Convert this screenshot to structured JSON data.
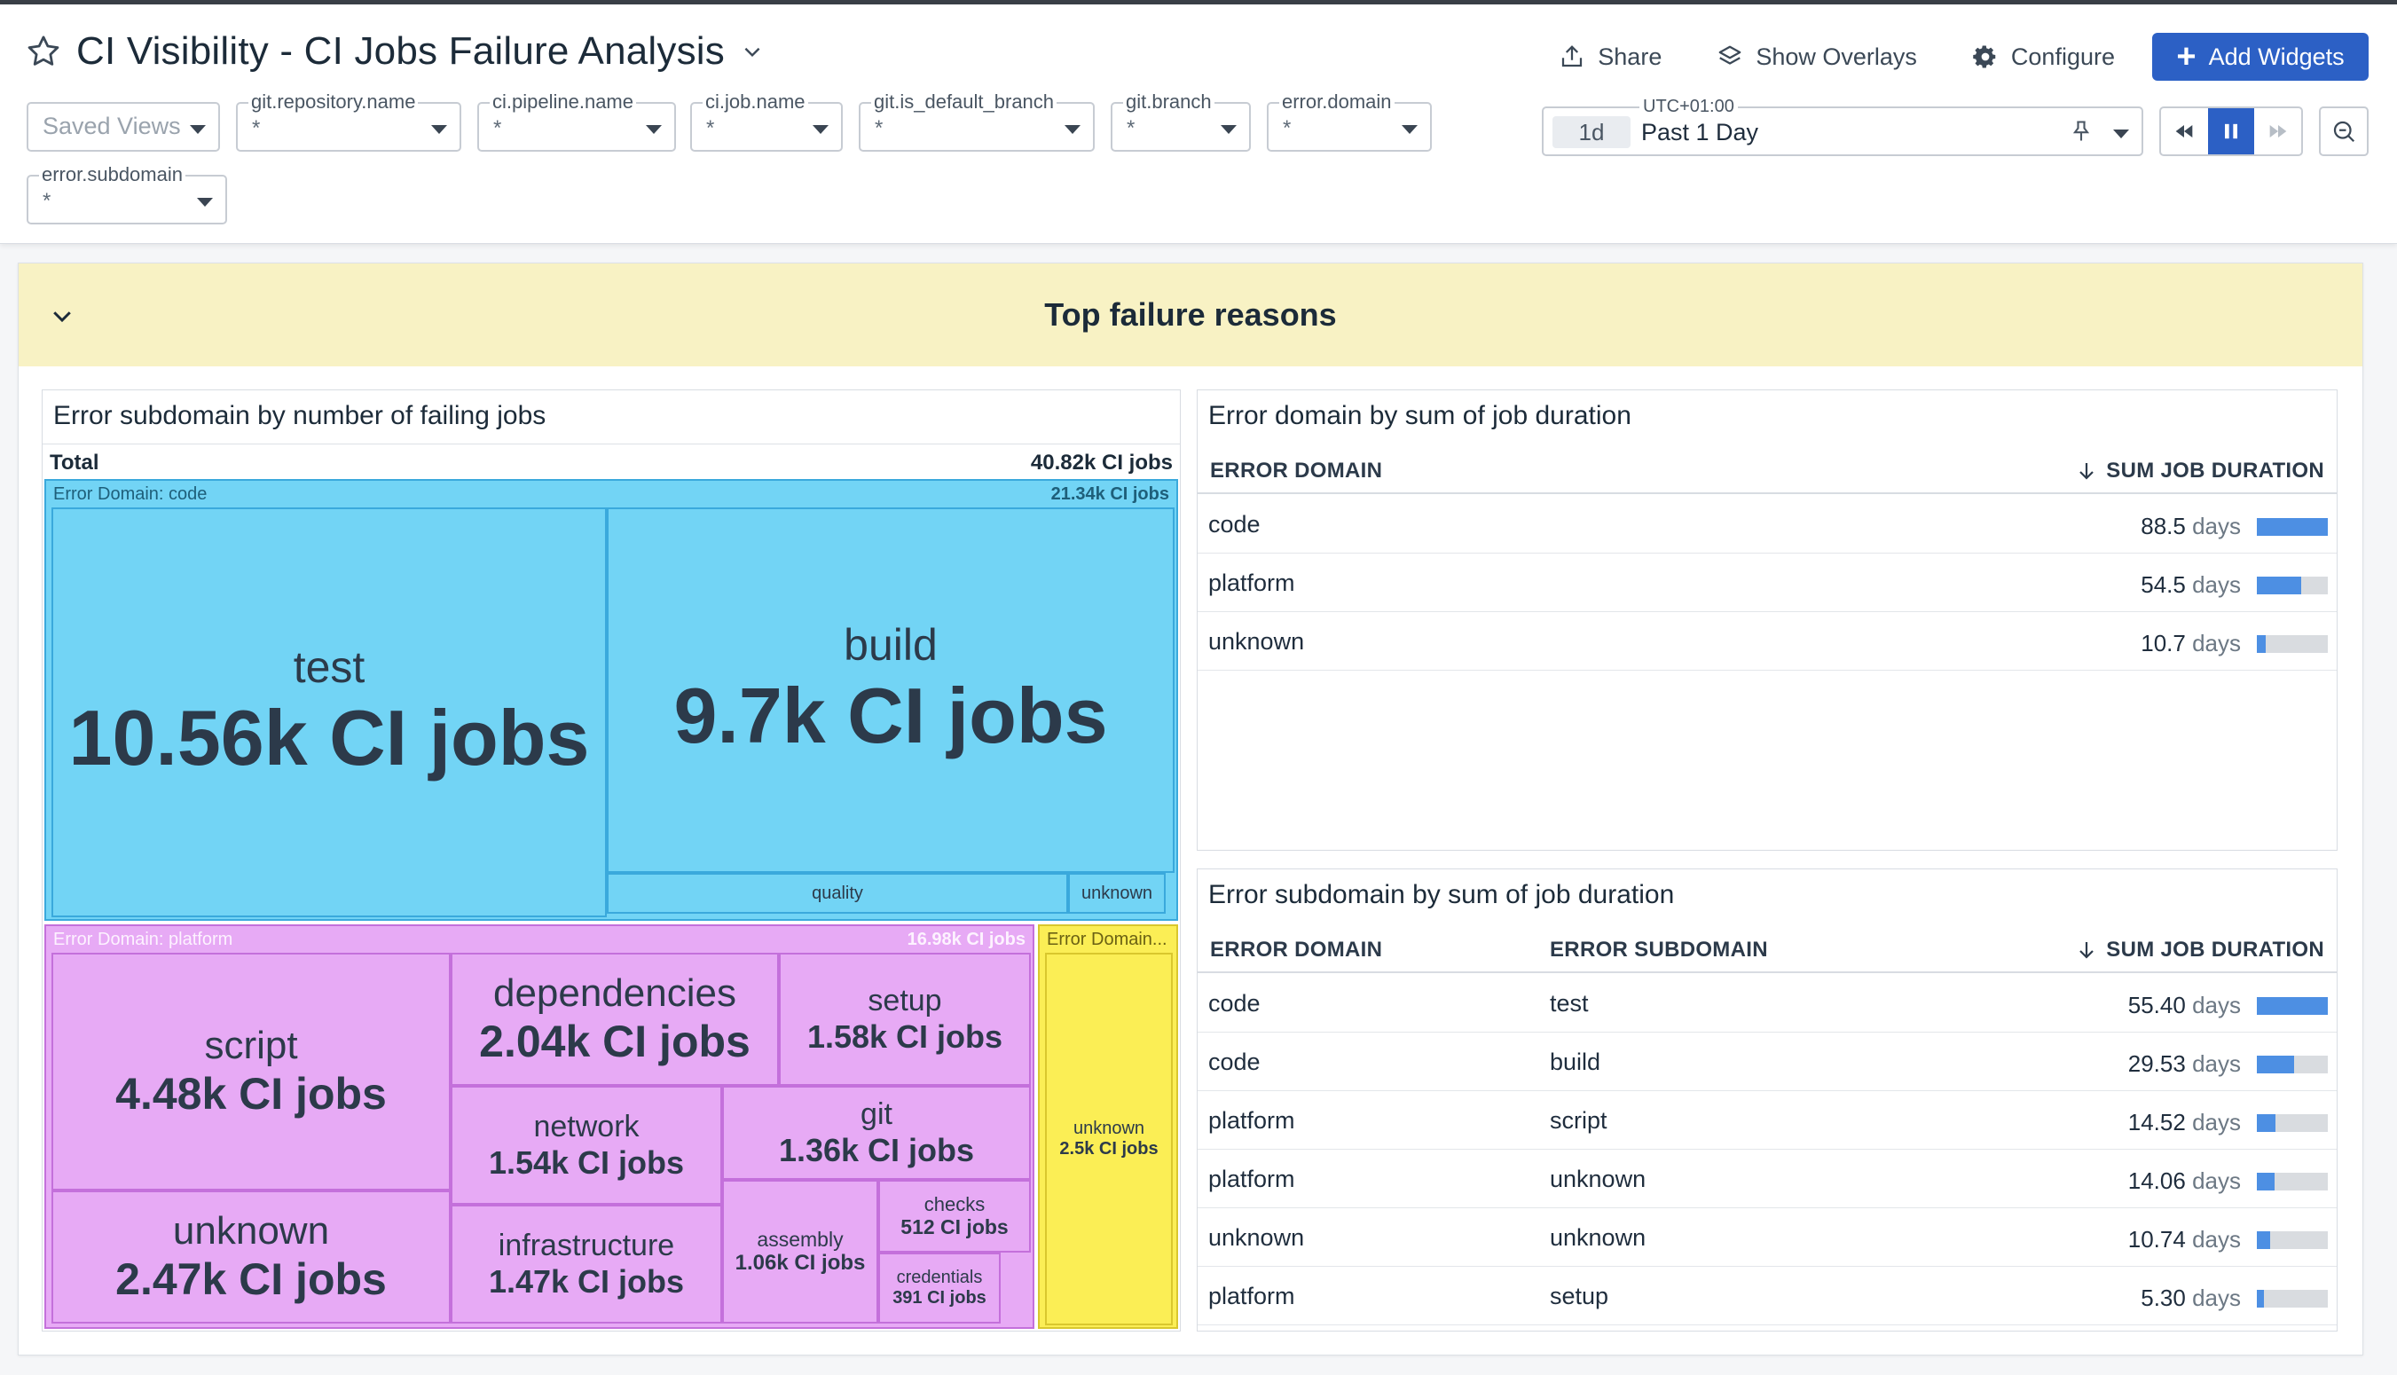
{
  "header": {
    "title": "CI Visibility - CI Jobs Failure Analysis",
    "actions": {
      "share": "Share",
      "overlays": "Show Overlays",
      "configure": "Configure",
      "add": "Add Widgets"
    },
    "saved_views": "Saved Views",
    "filters": [
      {
        "label": "git.repository.name",
        "value": "*"
      },
      {
        "label": "ci.pipeline.name",
        "value": "*"
      },
      {
        "label": "ci.job.name",
        "value": "*"
      },
      {
        "label": "git.is_default_branch",
        "value": "*"
      },
      {
        "label": "git.branch",
        "value": "*"
      },
      {
        "label": "error.domain",
        "value": "*"
      },
      {
        "label": "error.subdomain",
        "value": "*"
      }
    ],
    "time": {
      "timezone": "UTC+01:00",
      "short": "1d",
      "range": "Past 1 Day"
    }
  },
  "group": {
    "title": "Top failure reasons"
  },
  "treemap": {
    "title": "Error subdomain by number of failing jobs",
    "total_label": "Total",
    "total_value": "40.82k CI jobs",
    "groups": [
      {
        "label": "Error Domain: code",
        "value": "21.34k CI jobs"
      },
      {
        "label": "Error Domain: platform",
        "value": "16.98k CI jobs"
      },
      {
        "label": "Error Domain..."
      }
    ],
    "tiles": {
      "test": {
        "name": "test",
        "value": "10.56k CI jobs"
      },
      "build": {
        "name": "build",
        "value": "9.7k CI jobs"
      },
      "quality": {
        "name": "quality"
      },
      "code_unknown": {
        "name": "unknown"
      },
      "script": {
        "name": "script",
        "value": "4.48k CI jobs"
      },
      "plat_unknown": {
        "name": "unknown",
        "value": "2.47k CI jobs"
      },
      "dependencies": {
        "name": "dependencies",
        "value": "2.04k CI jobs"
      },
      "setup": {
        "name": "setup",
        "value": "1.58k CI jobs"
      },
      "network": {
        "name": "network",
        "value": "1.54k CI jobs"
      },
      "git": {
        "name": "git",
        "value": "1.36k CI jobs"
      },
      "infrastructure": {
        "name": "infrastructure",
        "value": "1.47k CI jobs"
      },
      "assembly": {
        "name": "assembly",
        "value": "1.06k CI jobs"
      },
      "checks": {
        "name": "checks",
        "value": "512 CI jobs"
      },
      "credentials": {
        "name": "credentials",
        "value": "391 CI jobs"
      },
      "unk_unknown": {
        "name": "unknown",
        "value": "2.5k CI jobs"
      }
    },
    "colors": {
      "code": "#72d4f5",
      "platform": "#e7aaf5",
      "unknown": "#fbee55"
    }
  },
  "domain_table": {
    "title": "Error domain by sum of job duration",
    "columns": [
      "ERROR DOMAIN",
      "SUM JOB DURATION"
    ],
    "rows": [
      {
        "domain": "code",
        "value": "88.5",
        "unit": "days",
        "fraction": 1.0
      },
      {
        "domain": "platform",
        "value": "54.5",
        "unit": "days",
        "fraction": 0.62
      },
      {
        "domain": "unknown",
        "value": "10.7",
        "unit": "days",
        "fraction": 0.12
      }
    ]
  },
  "subdomain_table": {
    "title": "Error subdomain by sum of job duration",
    "columns": [
      "ERROR DOMAIN",
      "ERROR SUBDOMAIN",
      "SUM JOB DURATION"
    ],
    "rows": [
      {
        "domain": "code",
        "subdomain": "test",
        "value": "55.40",
        "unit": "days",
        "fraction": 1.0
      },
      {
        "domain": "code",
        "subdomain": "build",
        "value": "29.53",
        "unit": "days",
        "fraction": 0.53
      },
      {
        "domain": "platform",
        "subdomain": "script",
        "value": "14.52",
        "unit": "days",
        "fraction": 0.26
      },
      {
        "domain": "platform",
        "subdomain": "unknown",
        "value": "14.06",
        "unit": "days",
        "fraction": 0.25
      },
      {
        "domain": "unknown",
        "subdomain": "unknown",
        "value": "10.74",
        "unit": "days",
        "fraction": 0.19
      },
      {
        "domain": "platform",
        "subdomain": "setup",
        "value": "5.30",
        "unit": "days",
        "fraction": 0.1
      }
    ]
  }
}
